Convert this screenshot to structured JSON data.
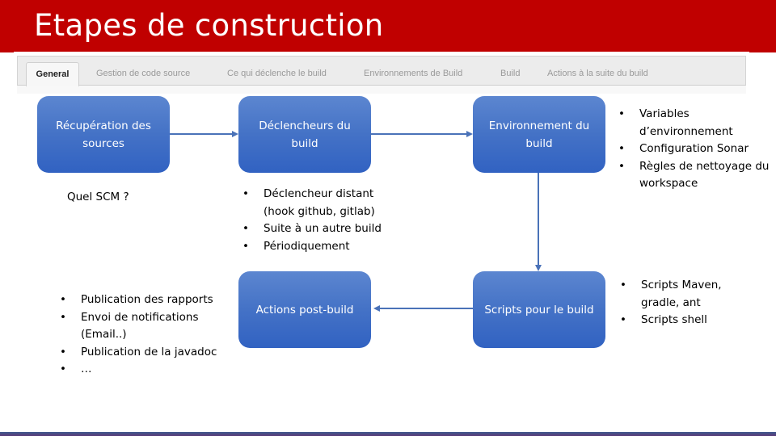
{
  "slide": {
    "title": "Etapes de construction",
    "colors": {
      "title_band": "#c00000",
      "box": "#4472c6",
      "arrow": "#4a72b8"
    }
  },
  "tabs": [
    {
      "label": "General",
      "active": true
    },
    {
      "label": "Gestion de code source",
      "active": false
    },
    {
      "label": "Ce qui déclenche le build",
      "active": false
    },
    {
      "label": "Environnements de Build",
      "active": false
    },
    {
      "label": "Build",
      "active": false
    },
    {
      "label": "Actions à la suite du build",
      "active": false
    }
  ],
  "steps": {
    "scm": {
      "label": "Récupération des sources",
      "note": "Quel SCM ?"
    },
    "triggers": {
      "label": "Déclencheurs du build",
      "bullets": [
        "Déclencheur distant (hook github, gitlab)",
        "Suite à un autre build",
        "Périodiquement"
      ]
    },
    "environment": {
      "label": "Environnement du build",
      "bullets": [
        "Variables d’environnement",
        "Configuration Sonar",
        "Règles de nettoyage du workspace"
      ]
    },
    "scripts": {
      "label": "Scripts pour le build",
      "bullets": [
        "Scripts Maven, gradle, ant",
        "Scripts shell"
      ]
    },
    "post_build": {
      "label": "Actions post-build",
      "bullets": [
        "Publication des rapports",
        "Envoi de notifications (Email..)",
        "Publication de la javadoc",
        "…"
      ]
    }
  },
  "bullet_glyph": "•"
}
